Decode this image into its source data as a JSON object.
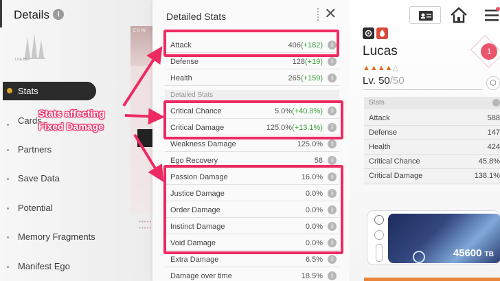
{
  "left": {
    "title": "Details",
    "logo_text": "LOE BEF",
    "nav": [
      {
        "label": "Stats",
        "active": true
      },
      {
        "label": "Cards"
      },
      {
        "label": "Partners"
      },
      {
        "label": "Save Data"
      },
      {
        "label": "Potential"
      },
      {
        "label": "Memory Fragments"
      },
      {
        "label": "Manifest Ego"
      }
    ],
    "strip_label": "EGIN"
  },
  "mid": {
    "title": "Detailed Stats",
    "base_rows": [
      {
        "name": "Attack",
        "value": "406",
        "bonus": "(+182)"
      },
      {
        "name": "Defense",
        "value": "128",
        "bonus": "(+19)"
      },
      {
        "name": "Health",
        "value": "265",
        "bonus": "(+159)"
      }
    ],
    "section_label": "Detailed Stats",
    "detail_rows": [
      {
        "name": "Critical Chance",
        "value": "5.0%",
        "bonus": "(+40.8%)"
      },
      {
        "name": "Critical Damage",
        "value": "125.0%",
        "bonus": "(+13.1%)"
      },
      {
        "name": "Weakness Damage",
        "value": "125.0%",
        "bonus": ""
      },
      {
        "name": "Ego Recovery",
        "value": "58",
        "bonus": ""
      },
      {
        "name": "Passion Damage",
        "value": "16.0%",
        "bonus": ""
      },
      {
        "name": "Justice Damage",
        "value": "0.0%",
        "bonus": ""
      },
      {
        "name": "Order Damage",
        "value": "0.0%",
        "bonus": ""
      },
      {
        "name": "Instinct Damage",
        "value": "0.0%",
        "bonus": ""
      },
      {
        "name": "Void Damage",
        "value": "0.0%",
        "bonus": ""
      },
      {
        "name": "Extra Damage",
        "value": "6.5%",
        "bonus": ""
      },
      {
        "name": "Damage over time",
        "value": "18.5%",
        "bonus": ""
      }
    ]
  },
  "right": {
    "name": "Lucas",
    "stars": "▲▲▲▲",
    "empty_star": "△",
    "level_prefix": "Lv. 50",
    "level_max": "/50",
    "affection": "1",
    "stats_header": "Stats",
    "stats": [
      {
        "name": "Attack",
        "value": "588"
      },
      {
        "name": "Defense",
        "value": "147"
      },
      {
        "name": "Health",
        "value": "424"
      },
      {
        "name": "Critical Chance",
        "value": "45.8%"
      },
      {
        "name": "Critical Damage",
        "value": "138.1%"
      }
    ],
    "card_value": "45600",
    "card_unit": "TB"
  },
  "annotation": {
    "line1": "Stats affecting",
    "line2": "Fixed Damage"
  },
  "colors": {
    "highlight": "#ee2a63",
    "bonus_green": "#3aa13a",
    "star_orange": "#e36b25"
  }
}
